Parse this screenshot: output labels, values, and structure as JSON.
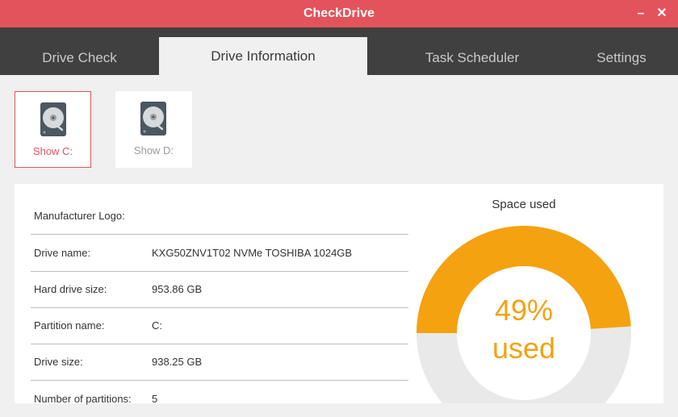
{
  "window": {
    "title": "CheckDrive",
    "minimize_glyph": "–",
    "close_glyph": "✕"
  },
  "tabs": [
    {
      "label": "Drive Check",
      "active": false
    },
    {
      "label": "Drive Information",
      "active": true
    },
    {
      "label": "Task Scheduler",
      "active": false
    },
    {
      "label": "Settings",
      "active": false
    }
  ],
  "drives": [
    {
      "label": "Show C:",
      "selected": true,
      "icon": "hard-drive-icon"
    },
    {
      "label": "Show D:",
      "selected": false,
      "icon": "hard-drive-icon"
    }
  ],
  "info": {
    "rows": [
      {
        "key": "Manufacturer Logo:",
        "value": ""
      },
      {
        "key": "Drive name:",
        "value": "KXG50ZNV1T02 NVMe TOSHIBA 1024GB"
      },
      {
        "key": "Hard drive size:",
        "value": "953.86 GB"
      },
      {
        "key": "Partition name:",
        "value": "C:"
      },
      {
        "key": "Drive size:",
        "value": "938.25 GB"
      },
      {
        "key": "Number of partitions:",
        "value": "5"
      }
    ]
  },
  "space": {
    "title": "Space used",
    "percent_text": "49%",
    "used_text": "used",
    "used_fraction": 0.49
  },
  "colors": {
    "accent": "#e3535b",
    "tab_bar": "#404040",
    "donut_used": "#f4a20f",
    "donut_free": "#e9e9e9"
  }
}
